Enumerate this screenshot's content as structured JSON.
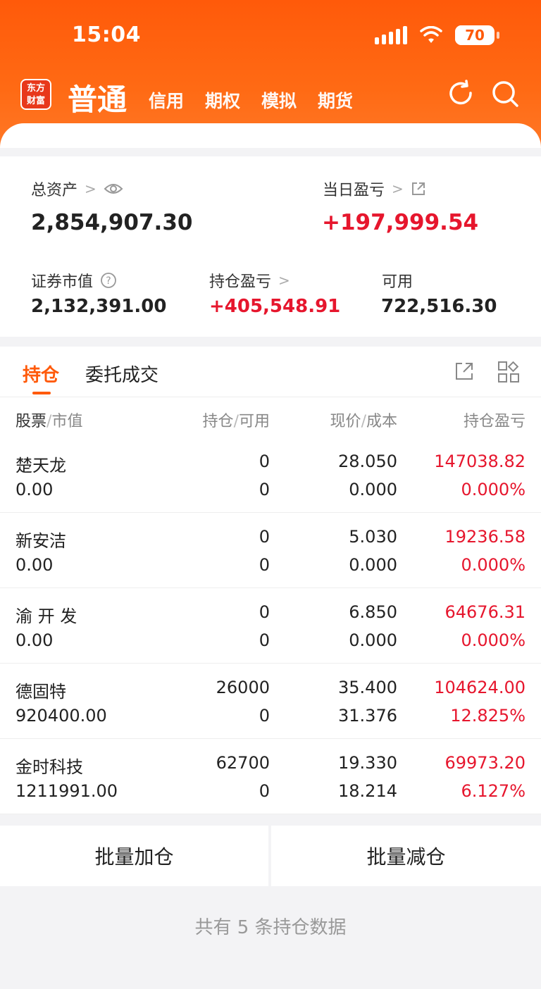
{
  "status_bar": {
    "time": "15:04",
    "battery": "70"
  },
  "header": {
    "logo_text": "东方财富",
    "active_tab": "普通",
    "tabs": [
      "信用",
      "期权",
      "模拟",
      "期货"
    ]
  },
  "summary": {
    "total_assets_label": "总资产",
    "total_assets_value": "2,854,907.30",
    "daily_pnl_label": "当日盈亏",
    "daily_pnl_value": "+197,999.54",
    "market_value_label": "证券市值",
    "market_value": "2,132,391.00",
    "holding_pnl_label": "持仓盈亏",
    "holding_pnl_value": "+405,548.91",
    "available_label": "可用",
    "available_value": "722,516.30"
  },
  "positions": {
    "tab_holdings": "持仓",
    "tab_orders": "委托成交",
    "columns": {
      "stock": "股票",
      "market_value": "市值",
      "holding": "持仓",
      "available": "可用",
      "price": "现价",
      "cost": "成本",
      "pnl": "持仓盈亏"
    },
    "rows": [
      {
        "name": "楚天龙",
        "market_value": "0.00",
        "holding": "0",
        "available": "0",
        "price": "28.050",
        "cost": "0.000",
        "pnl": "147038.82",
        "pnl_pct": "0.000%"
      },
      {
        "name": "新安洁",
        "market_value": "0.00",
        "holding": "0",
        "available": "0",
        "price": "5.030",
        "cost": "0.000",
        "pnl": "19236.58",
        "pnl_pct": "0.000%"
      },
      {
        "name": "渝 开 发",
        "market_value": "0.00",
        "holding": "0",
        "available": "0",
        "price": "6.850",
        "cost": "0.000",
        "pnl": "64676.31",
        "pnl_pct": "0.000%"
      },
      {
        "name": "德固特",
        "market_value": "920400.00",
        "holding": "26000",
        "available": "0",
        "price": "35.400",
        "cost": "31.376",
        "pnl": "104624.00",
        "pnl_pct": "12.825%"
      },
      {
        "name": "金时科技",
        "market_value": "1211991.00",
        "holding": "62700",
        "available": "0",
        "price": "19.330",
        "cost": "18.214",
        "pnl": "69973.20",
        "pnl_pct": "6.127%"
      }
    ]
  },
  "actions": {
    "batch_add": "批量加仓",
    "batch_reduce": "批量减仓"
  },
  "footer": {
    "note": "共有 5 条持仓数据"
  },
  "colors": {
    "brand_orange": "#ff5a0a",
    "profit_red": "#e6162d"
  },
  "icons": [
    "refresh-icon",
    "search-icon",
    "eye-icon",
    "external-link-icon",
    "help-icon",
    "grid-icon"
  ]
}
